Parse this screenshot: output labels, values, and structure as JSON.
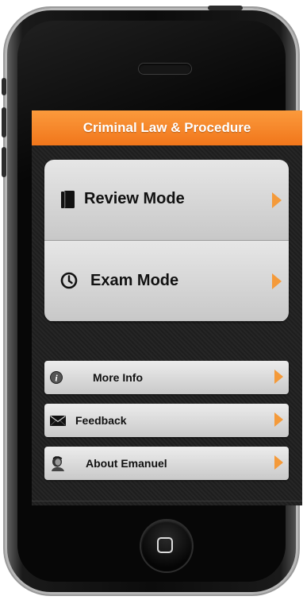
{
  "header": {
    "title": "Criminal Law & Procedure"
  },
  "main_menu": [
    {
      "label": "Review Mode",
      "icon": "book-icon"
    },
    {
      "label": "Exam Mode",
      "icon": "clock-icon"
    }
  ],
  "secondary_menu": [
    {
      "label": "More Info",
      "icon": "info-icon"
    },
    {
      "label": "Feedback",
      "icon": "envelope-icon"
    },
    {
      "label": "About Emanuel",
      "icon": "portrait-icon"
    }
  ],
  "colors": {
    "accent": "#f47d20",
    "arrow": "#f49a3a",
    "background": "#222222"
  }
}
